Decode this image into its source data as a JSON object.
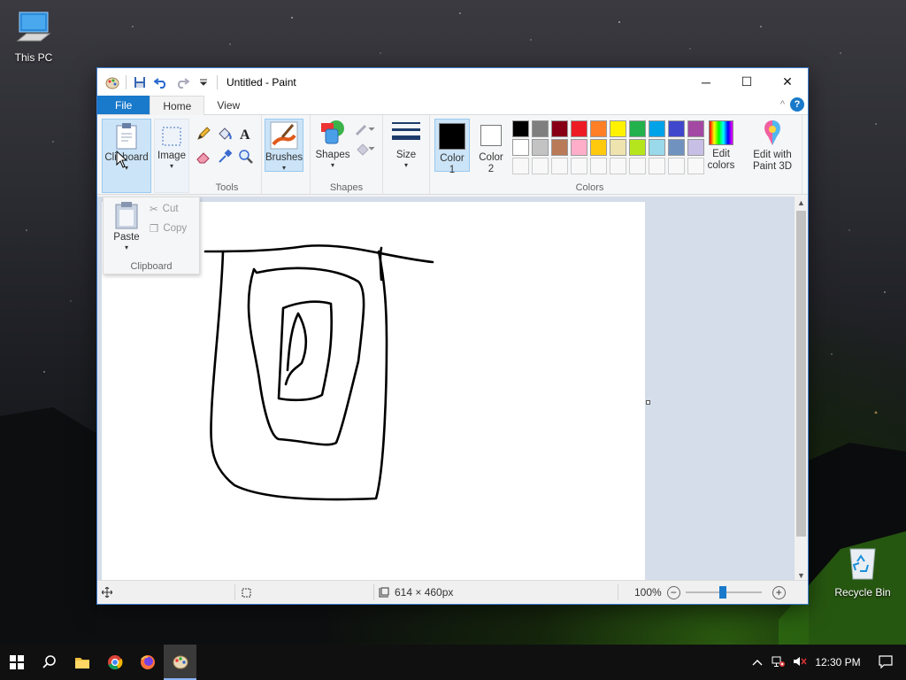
{
  "desktop": {
    "this_pc_label": "This PC",
    "recycle_bin_label": "Recycle Bin"
  },
  "window": {
    "title": "Untitled - Paint",
    "controls": {
      "minimize": "─",
      "maximize": "☐",
      "close": "✕"
    }
  },
  "tabs": {
    "file": "File",
    "home": "Home",
    "view": "View",
    "collapse": "^",
    "help": "?"
  },
  "ribbon": {
    "clipboard_label": "Clipboard",
    "image_label": "Image",
    "tools_group": "Tools",
    "brushes_label": "Brushes",
    "shapes_label": "Shapes",
    "shapes_group": "Shapes",
    "size_label": "Size",
    "color1_line1": "Color",
    "color1_line2": "1",
    "color2_line1": "Color",
    "color2_line2": "2",
    "colors_group": "Colors",
    "edit_colors_line1": "Edit",
    "edit_colors_line2": "colors",
    "paint3d_line1": "Edit with",
    "paint3d_line2": "Paint 3D",
    "palette_row1": [
      "#000000",
      "#7f7f7f",
      "#880015",
      "#ed1c24",
      "#ff7f27",
      "#fff200",
      "#22b14c",
      "#00a2e8",
      "#3f48cc",
      "#a349a4"
    ],
    "palette_row2": [
      "#ffffff",
      "#c3c3c3",
      "#b97a57",
      "#ffaec9",
      "#ffc90e",
      "#efe4b0",
      "#b5e61d",
      "#99d9ea",
      "#7092be",
      "#c8bfe7"
    ]
  },
  "clipboard_dropdown": {
    "paste": "Paste",
    "cut": "Cut",
    "copy": "Copy",
    "group_label": "Clipboard"
  },
  "statusbar": {
    "image_size": "614 × 460px",
    "zoom": "100%",
    "zoom_out": "−",
    "zoom_in": "+"
  },
  "taskbar": {
    "time": "12:30 PM"
  }
}
